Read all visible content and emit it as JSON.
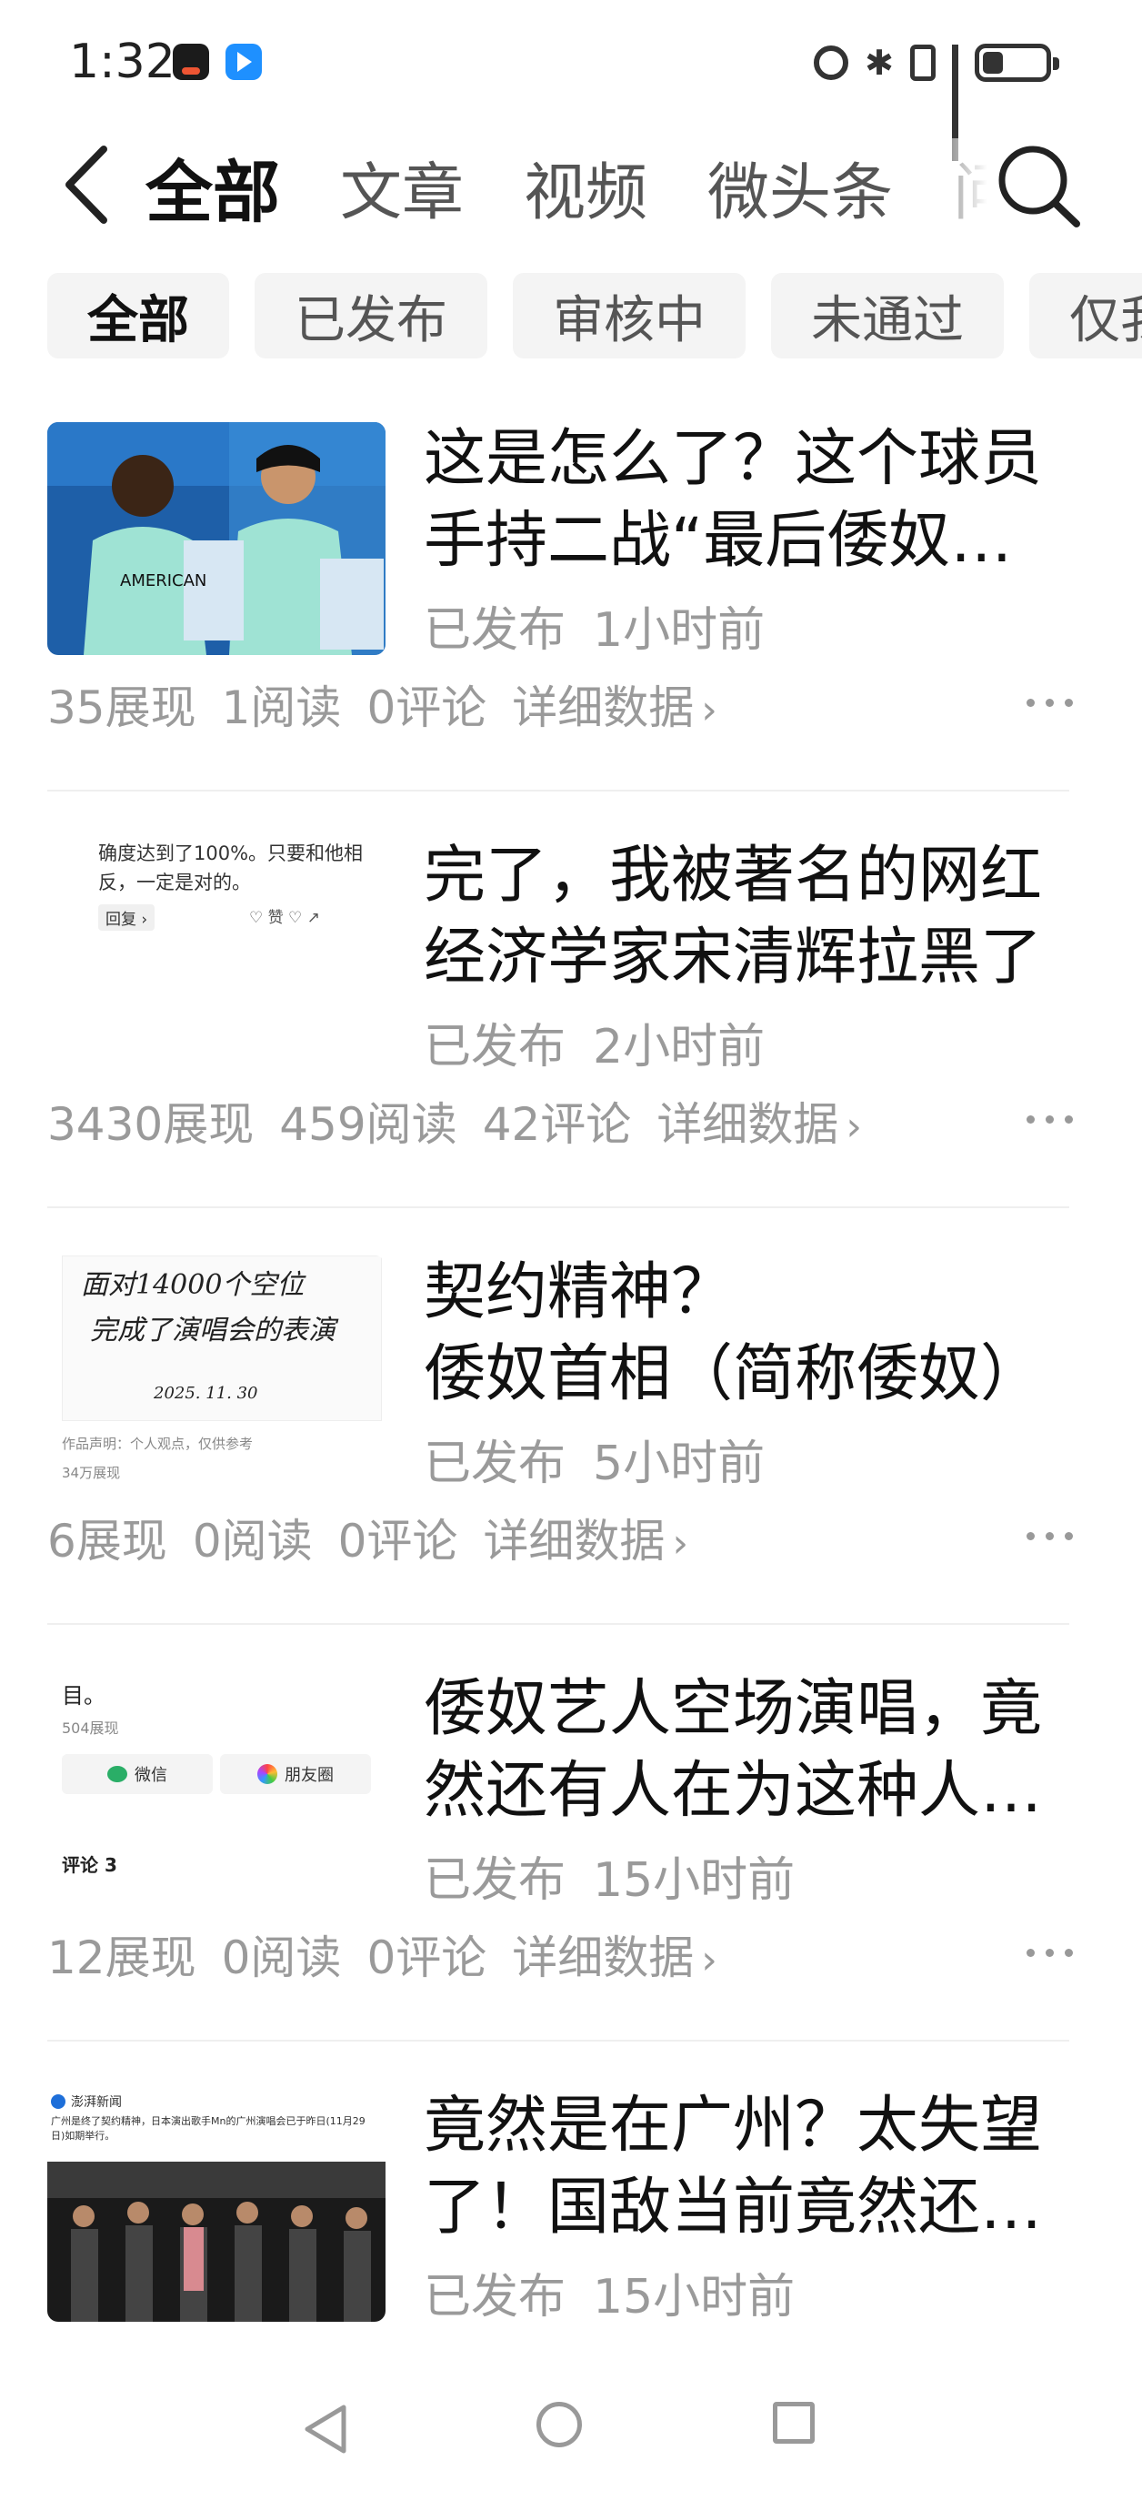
{
  "status_bar": {
    "time": "1:32"
  },
  "top_tabs": [
    {
      "label": "全部",
      "active": true
    },
    {
      "label": "文章",
      "active": false
    },
    {
      "label": "视频",
      "active": false
    },
    {
      "label": "微头条",
      "active": false
    },
    {
      "label": "问答",
      "active": false
    }
  ],
  "filter_chips": [
    {
      "label": "全部",
      "active": true
    },
    {
      "label": "已发布",
      "active": false
    },
    {
      "label": "审核中",
      "active": false
    },
    {
      "label": "未通过",
      "active": false
    },
    {
      "label": "仅我可见",
      "active": false
    }
  ],
  "articles": [
    {
      "title": "这是怎么了？这个球员手持二战“最后倭奴兵”照片",
      "status": "已发布",
      "time": "1小时前",
      "impressions": "35展现",
      "reads": "1阅读",
      "comments": "0评论",
      "detail": "详细数据",
      "thumb": "football"
    },
    {
      "title": "完了，我被著名的网红经济学家宋清辉拉黑了",
      "status": "已发布",
      "time": "2小时前",
      "impressions": "3430展现",
      "reads": "459阅读",
      "comments": "42评论",
      "detail": "详细数据",
      "thumb": "screenshot",
      "thumb_text": {
        "line1": "确度达到了100%。只要和他相",
        "line2": "反，一定是对的。",
        "reply": "回复 ›",
        "like": "赞"
      }
    },
    {
      "title": "契约精神？\n倭奴首相（简称倭奴）",
      "status": "已发布",
      "time": "5小时前",
      "impressions": "6展现",
      "reads": "0阅读",
      "comments": "0评论",
      "detail": "详细数据",
      "thumb": "handwriting",
      "thumb_text": {
        "line1": "面对14000个空位",
        "line2": "完成了演唱会的表演",
        "date": "2025. 11. 30",
        "note": "作品声明：个人观点，仅供参考",
        "views": "34万展现"
      }
    },
    {
      "title": "倭奴艺人空场演唱，竟然还有人在为这种人叫好",
      "status": "已发布",
      "time": "15小时前",
      "impressions": "12展现",
      "reads": "0阅读",
      "comments": "0评论",
      "detail": "详细数据",
      "thumb": "share",
      "thumb_text": {
        "top": "目。",
        "views": "504展现",
        "wechat": "微信",
        "moments": "朋友圈",
        "comments": "评论 3"
      }
    },
    {
      "title": "竟然是在广州？太失望了！国敌当前竟然还有这种事",
      "status": "已发布",
      "time": "15小时前",
      "impressions": "",
      "reads": "",
      "comments": "",
      "detail": "",
      "thumb": "concert",
      "thumb_text": {
        "account": "澎湃新闻",
        "caption": "广州是终了契约精神，日本演出歌手Mn的广州演唱会已于昨日(11月29日)如期举行。"
      }
    }
  ],
  "colors": {
    "muted": "#9a9a9a",
    "chip_bg": "#f4f4f4",
    "divider": "#efefef"
  },
  "icons": [
    "back-icon",
    "search-icon",
    "more-icon",
    "chevron-right-icon"
  ]
}
